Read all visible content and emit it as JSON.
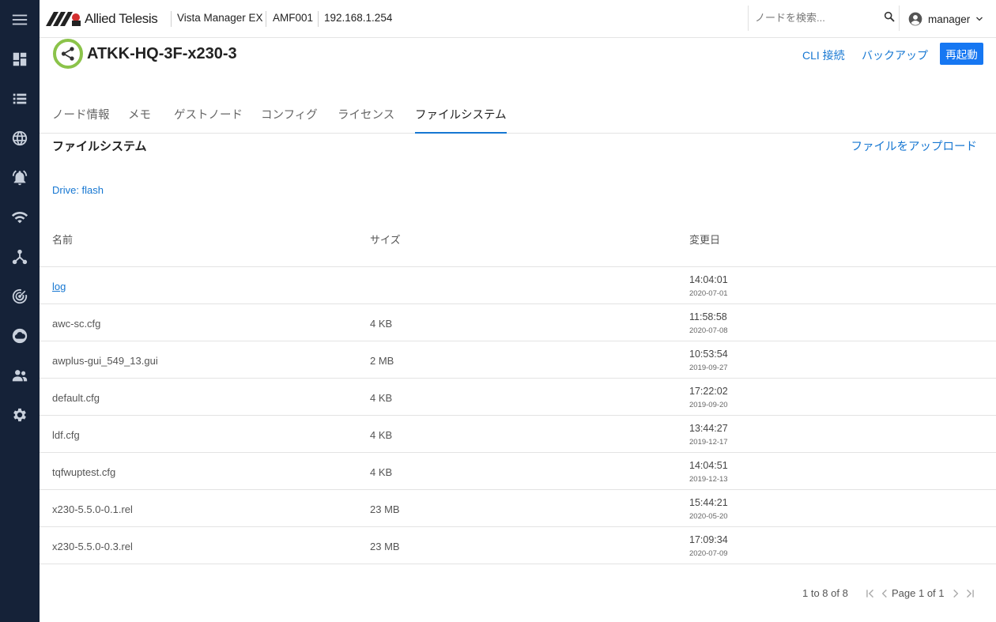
{
  "app": {
    "brand": "Allied Telesis",
    "product": "Vista Manager EX",
    "area": "AMF001",
    "ip": "192.168.1.254"
  },
  "search": {
    "placeholder": "ノードを検索..."
  },
  "user": {
    "name": "manager"
  },
  "sidebar": {
    "icons": [
      "menu-icon",
      "dashboard-icon",
      "list-icon",
      "globe-icon",
      "alarm-icon",
      "wifi-icon",
      "topology-icon",
      "radar-icon",
      "cloud-icon",
      "users-icon",
      "gear-icon"
    ]
  },
  "node": {
    "name": "ATKK-HQ-3F-x230-3",
    "status_color": "#8bc34a",
    "actions": {
      "cli": "CLI 接続",
      "backup": "バックアップ",
      "reboot": "再起動"
    }
  },
  "tabs": [
    {
      "label": "ノード情報"
    },
    {
      "label": "メモ"
    },
    {
      "label": "ゲストノード"
    },
    {
      "label": "コンフィグ"
    },
    {
      "label": "ライセンス"
    },
    {
      "label": "ファイルシステム",
      "active": true
    }
  ],
  "filesystem": {
    "title": "ファイルシステム",
    "upload_label": "ファイルをアップロード",
    "drive": "Drive: flash",
    "columns": {
      "name": "名前",
      "size": "サイズ",
      "modified": "変更日"
    },
    "rows": [
      {
        "name": "log",
        "size": "",
        "time": "14:04:01",
        "date": "2020-07-01",
        "is_dir": true
      },
      {
        "name": "awc-sc.cfg",
        "size": "4 KB",
        "time": "11:58:58",
        "date": "2020-07-08"
      },
      {
        "name": "awplus-gui_549_13.gui",
        "size": "2 MB",
        "time": "10:53:54",
        "date": "2019-09-27"
      },
      {
        "name": "default.cfg",
        "size": "4 KB",
        "time": "17:22:02",
        "date": "2019-09-20"
      },
      {
        "name": "ldf.cfg",
        "size": "4 KB",
        "time": "13:44:27",
        "date": "2019-12-17"
      },
      {
        "name": "tqfwuptest.cfg",
        "size": "4 KB",
        "time": "14:04:51",
        "date": "2019-12-13"
      },
      {
        "name": "x230-5.5.0-0.1.rel",
        "size": "23 MB",
        "time": "15:44:21",
        "date": "2020-05-20"
      },
      {
        "name": "x230-5.5.0-0.3.rel",
        "size": "23 MB",
        "time": "17:09:34",
        "date": "2020-07-09"
      }
    ]
  },
  "pager": {
    "range": "1 to 8 of 8",
    "page": "Page 1 of 1"
  },
  "colors": {
    "accent": "#1677d2",
    "primary_button": "#1677f2",
    "rail": "#152238"
  }
}
